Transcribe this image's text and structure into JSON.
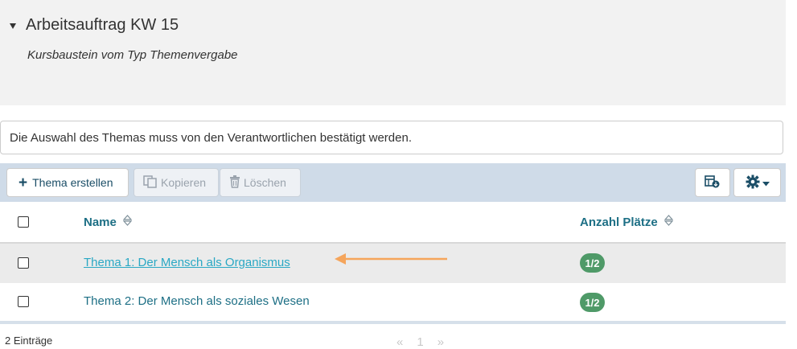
{
  "header": {
    "title": "Arbeitsauftrag KW 15",
    "subtitle": "Kursbaustein vom Typ Themenvergabe"
  },
  "notice": "Die Auswahl des Themas muss von den Verantwortlichen bestätigt werden.",
  "toolbar": {
    "create_label": "Thema erstellen",
    "copy_label": "Kopieren",
    "delete_label": "Löschen"
  },
  "table": {
    "columns": [
      "Name",
      "Anzahl Plätze"
    ],
    "rows": [
      {
        "name": "Thema 1: Der Mensch als Organismus",
        "places": "1/2"
      },
      {
        "name": "Thema 2: Der Mensch als soziales Wesen",
        "places": "1/2"
      }
    ]
  },
  "footer": {
    "count": "2 Einträge",
    "prev": "«",
    "page": "1",
    "next": "»"
  },
  "colors": {
    "accent": "#1d6f85",
    "badge": "#4f9a68",
    "annotation_arrow": "#f5a55b"
  }
}
